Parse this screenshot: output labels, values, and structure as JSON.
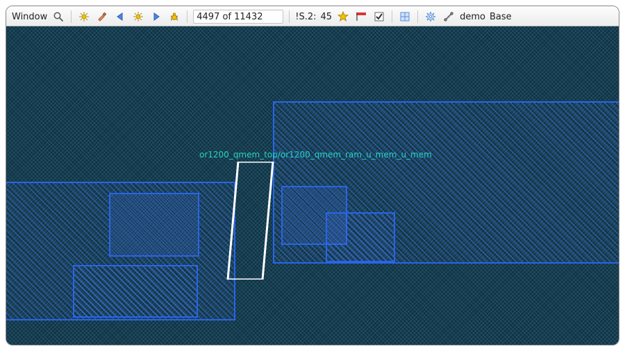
{
  "toolbar": {
    "window_menu": "Window",
    "counter_value": "4497 of 11432",
    "status2_label": "!S.2:",
    "status2_value": "45",
    "mode1": "demo",
    "mode2": "Base"
  },
  "canvas": {
    "net_label": "or1200_qmem_top/or1200_qmem_ram_u_mem_u_mem"
  }
}
